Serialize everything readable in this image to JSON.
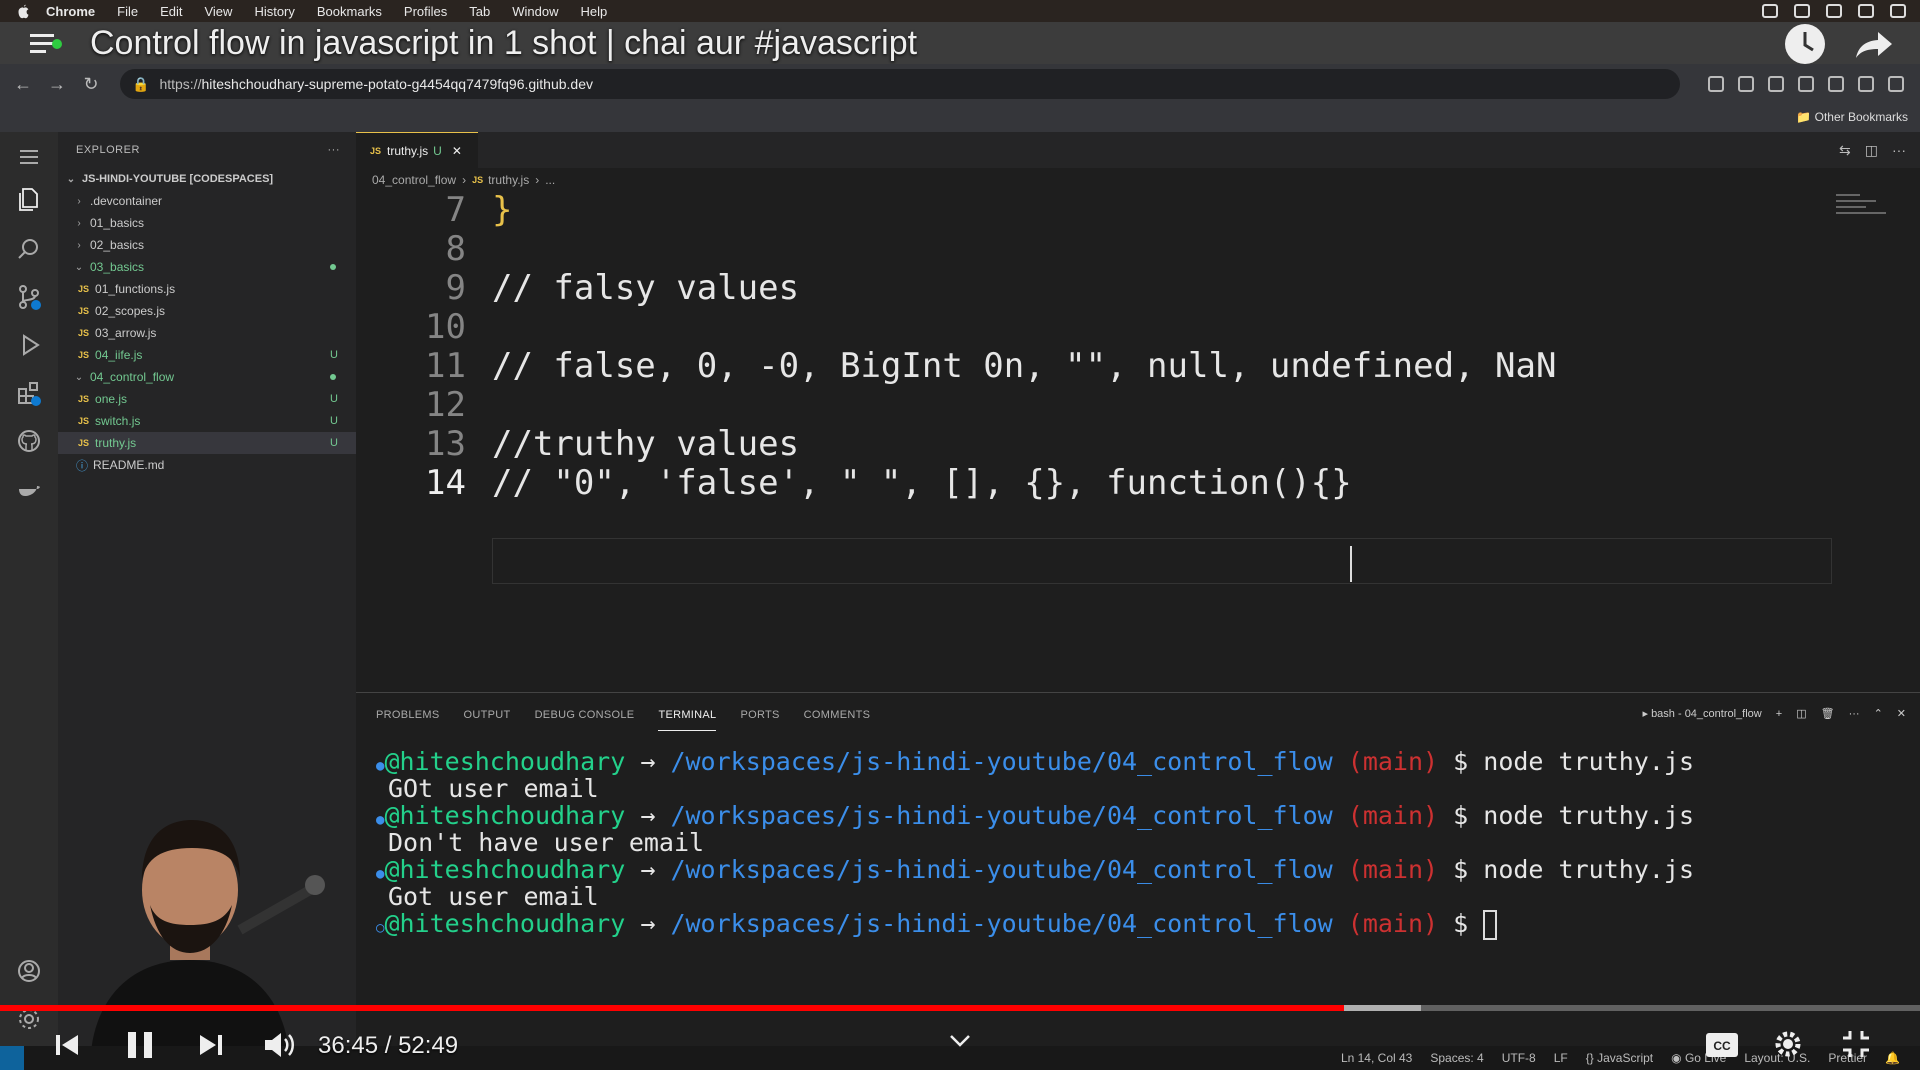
{
  "menubar": {
    "items": [
      "Chrome",
      "File",
      "Edit",
      "View",
      "History",
      "Bookmarks",
      "Profiles",
      "Tab",
      "Window",
      "Help"
    ]
  },
  "youtube": {
    "video_title": "Control flow in javascript in 1 shot | chai aur #javascript",
    "current_time": "36:45",
    "duration": "52:49",
    "progress": 0.7,
    "buffered": 0.74
  },
  "browser": {
    "url_prefix": "https://",
    "url_host": "hiteshchoudhary-supreme-potato-g4454qq7479fq96.github.dev",
    "bookmarks_label": "Other Bookmarks"
  },
  "explorer": {
    "header": "EXPLORER",
    "workspace": "JS-HINDI-YOUTUBE [CODESPACES]",
    "tree": [
      {
        "name": ".devcontainer",
        "type": "folder",
        "depth": 1,
        "open": false
      },
      {
        "name": "01_basics",
        "type": "folder",
        "depth": 1,
        "open": false
      },
      {
        "name": "02_basics",
        "type": "folder",
        "depth": 1,
        "open": false
      },
      {
        "name": "03_basics",
        "type": "folder",
        "depth": 1,
        "open": true,
        "modified": true
      },
      {
        "name": "01_functions.js",
        "type": "js",
        "depth": 2
      },
      {
        "name": "02_scopes.js",
        "type": "js",
        "depth": 2
      },
      {
        "name": "03_arrow.js",
        "type": "js",
        "depth": 2
      },
      {
        "name": "04_iife.js",
        "type": "js",
        "depth": 2,
        "badge": "U"
      },
      {
        "name": "04_control_flow",
        "type": "folder",
        "depth": 1,
        "open": true,
        "modified": true
      },
      {
        "name": "one.js",
        "type": "js",
        "depth": 2,
        "badge": "U"
      },
      {
        "name": "switch.js",
        "type": "js",
        "depth": 2,
        "badge": "U"
      },
      {
        "name": "truthy.js",
        "type": "js",
        "depth": 2,
        "badge": "U",
        "selected": true
      },
      {
        "name": "README.md",
        "type": "info",
        "depth": 1
      }
    ]
  },
  "editor": {
    "tab_label": "truthy.js",
    "tab_badge": "U",
    "breadcrumb": [
      "04_control_flow",
      "truthy.js",
      "..."
    ],
    "lines": [
      {
        "n": "7",
        "text": "}",
        "kind": "brace"
      },
      {
        "n": "8",
        "text": "",
        "kind": "cmt"
      },
      {
        "n": "9",
        "text": "// falsy values",
        "kind": "cmt"
      },
      {
        "n": "10",
        "text": "",
        "kind": "cmt"
      },
      {
        "n": "11",
        "text": "// false, 0, -0, BigInt 0n, \"\", null, undefined, NaN",
        "kind": "cmt"
      },
      {
        "n": "12",
        "text": "",
        "kind": "cmt"
      },
      {
        "n": "13",
        "text": "//truthy values",
        "kind": "cmt"
      },
      {
        "n": "14",
        "text": "// \"0\", 'false', \" \", [], {}, function(){}",
        "kind": "cmt",
        "current": true
      }
    ]
  },
  "panel": {
    "tabs": [
      "PROBLEMS",
      "OUTPUT",
      "DEBUG CONSOLE",
      "TERMINAL",
      "PORTS",
      "COMMENTS"
    ],
    "active_tab": "TERMINAL",
    "terminal_name": "bash - 04_control_flow",
    "terminal": {
      "user": "@hiteshchoudhary",
      "arrow": "→",
      "path": "/workspaces/js-hindi-youtube/04_control_flow",
      "branch": "(main)",
      "prompt": "$",
      "command": "node truthy.js",
      "outputs": [
        "GOt user email",
        "Don't have user email",
        "Got user email"
      ]
    }
  },
  "statusbar": {
    "position": "Ln 14, Col 43",
    "spaces": "Spaces: 4",
    "encoding": "UTF-8",
    "eol": "LF",
    "language": "JavaScript",
    "golive": "Go Live",
    "layout": "Layout: U.S.",
    "prettier": "Prettier"
  },
  "colors": {
    "accent_red": "#ff0000",
    "terminal_user": "#23d18b",
    "terminal_path": "#3b8eea",
    "terminal_branch": "#cd3131",
    "git_untracked": "#73c991",
    "js_icon": "#e8c14a"
  }
}
